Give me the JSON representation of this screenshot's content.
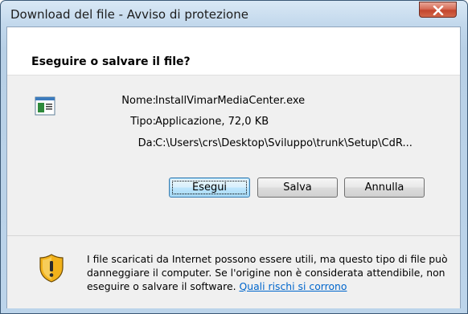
{
  "window": {
    "title": "Download del file - Avviso di protezione"
  },
  "dialog": {
    "heading": "Eseguire o salvare il file?",
    "fields": {
      "name_label": "Nome:",
      "name_value": "InstallVimarMediaCenter.exe",
      "type_label": "Tipo:",
      "type_value": "Applicazione, 72,0 KB",
      "from_label": "Da:",
      "from_value": "C:\\Users\\crs\\Desktop\\Sviluppo\\trunk\\Setup\\CdR..."
    },
    "buttons": {
      "run_label": "Esegui",
      "save_label": "Salva",
      "cancel_label": "Annulla"
    },
    "warning": {
      "text": "I file scaricati da Internet possono essere utili, ma questo tipo di file può danneggiare il computer. Se l'origine non è considerata attendibile, non eseguire o salvare il software. ",
      "link_text": "Quali rischi si corrono"
    }
  },
  "icons": {
    "close": "close-icon",
    "file": "application-file-icon",
    "warning": "security-shield-icon"
  },
  "colors": {
    "link": "#0066cc",
    "close_button": "#c3462d",
    "title_bar": "#c2d8ec"
  }
}
